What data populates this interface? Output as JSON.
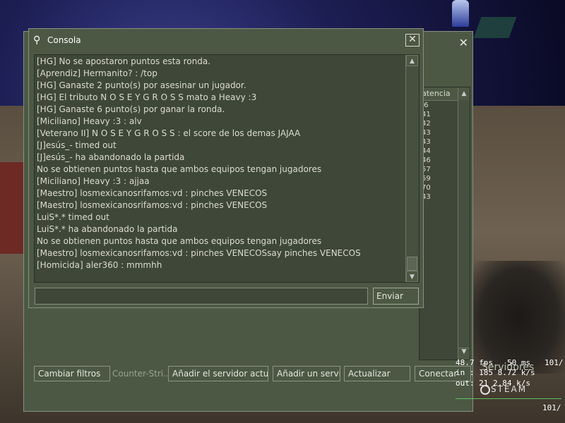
{
  "console": {
    "title": "Consola",
    "close_glyph": "✕",
    "lines": [
      "[HG] No se apostaron puntos esta ronda.",
      "[Aprendiz] Hermanito? : /top",
      "[HG] Ganaste 2 punto(s) por asesinar un jugador.",
      "[HG] El tributo N O S E Y G R O S S mato a Heavy :3",
      "[HG] Ganaste 6 punto(s) por ganar la ronda.",
      "[Miciliano] Heavy :3 : alv",
      "[Veterano II] N O S E Y G R O S S : el score de los demas JAJAA",
      "[J]esús_- timed out",
      "[J]esús_- ha abandonado la partida",
      "No se obtienen puntos hasta que ambos equipos tengan jugadores",
      "[Miciliano] Heavy :3 : ajjaa",
      "[Maestro] losmexicanosrifamos:vd : pinches VENECOS",
      "[Maestro] losmexicanosrifamos:vd : pinches VENECOS",
      "LuiS*.* timed out",
      "LuiS*.* ha abandonado la partida",
      "No se obtienen puntos hasta que ambos equipos tengan jugadores",
      "[Maestro] losmexicanosrifamos:vd : pinches VENECOSsay pinches VENECOS",
      "[Homicida] aler360 : mmmhh"
    ],
    "input_value": "",
    "send_label": "Enviar"
  },
  "server_browser": {
    "close_glyph": "✕",
    "latency_header": "atencia",
    "latency_values": [
      ".6",
      "41",
      "42",
      "43",
      "43",
      "44",
      "46",
      "57",
      "59",
      "70",
      "43"
    ],
    "buttons": {
      "change_filters": "Cambiar filtros",
      "game_label": "Counter-Stri...",
      "add_server_current": "Añadir el servidor actua",
      "add_server": "Añadir un servi...",
      "refresh": "Actualizar",
      "connect": "Conectar"
    }
  },
  "hud": {
    "fps": "48.7 fps",
    "ms": "50 ms",
    "rate_top": "101/",
    "in": "in : 185 8.72 k/s",
    "out": "out: 21 2.84 k/s",
    "servers_label": "Servidores",
    "steam": "STEAM",
    "rate_bottom": "101/"
  }
}
